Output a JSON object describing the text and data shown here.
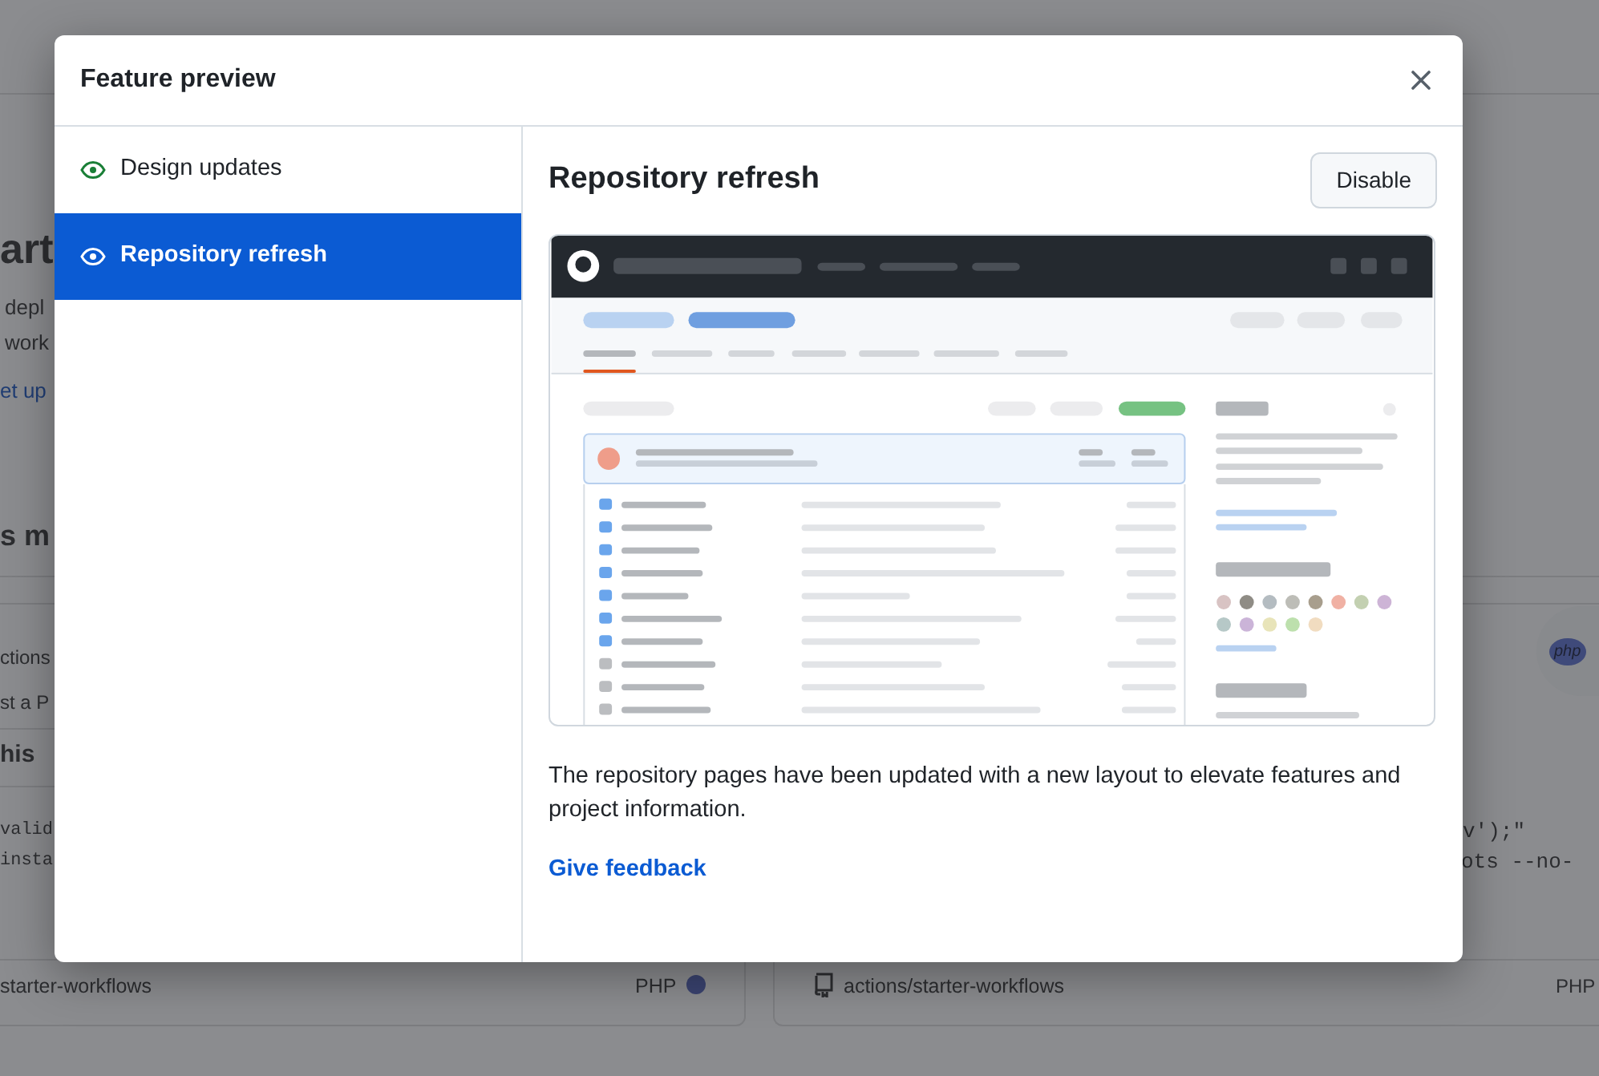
{
  "background": {
    "heading": "art",
    "intro": [
      "depl",
      "work"
    ],
    "link": "et up",
    "section_title": "s m",
    "left_card": {
      "lines": [
        "ctions",
        "st a P"
      ],
      "subtitle": "his",
      "code": [
        "valid",
        "insta"
      ],
      "repo": "starter-workflows",
      "language": "PHP"
    },
    "right_card": {
      "logo": "php",
      "code": [
        "v');\"",
        "ots --no-"
      ],
      "repo": "actions/starter-workflows",
      "language": "PHP"
    }
  },
  "dialog": {
    "title": "Feature preview",
    "features": [
      {
        "label": "Design updates",
        "selected": false
      },
      {
        "label": "Repository refresh",
        "selected": true
      }
    ],
    "detail": {
      "title": "Repository refresh",
      "button": "Disable",
      "description": "The repository pages have been updated with a new layout to elevate features and project information.",
      "link": "Give feedback"
    }
  }
}
